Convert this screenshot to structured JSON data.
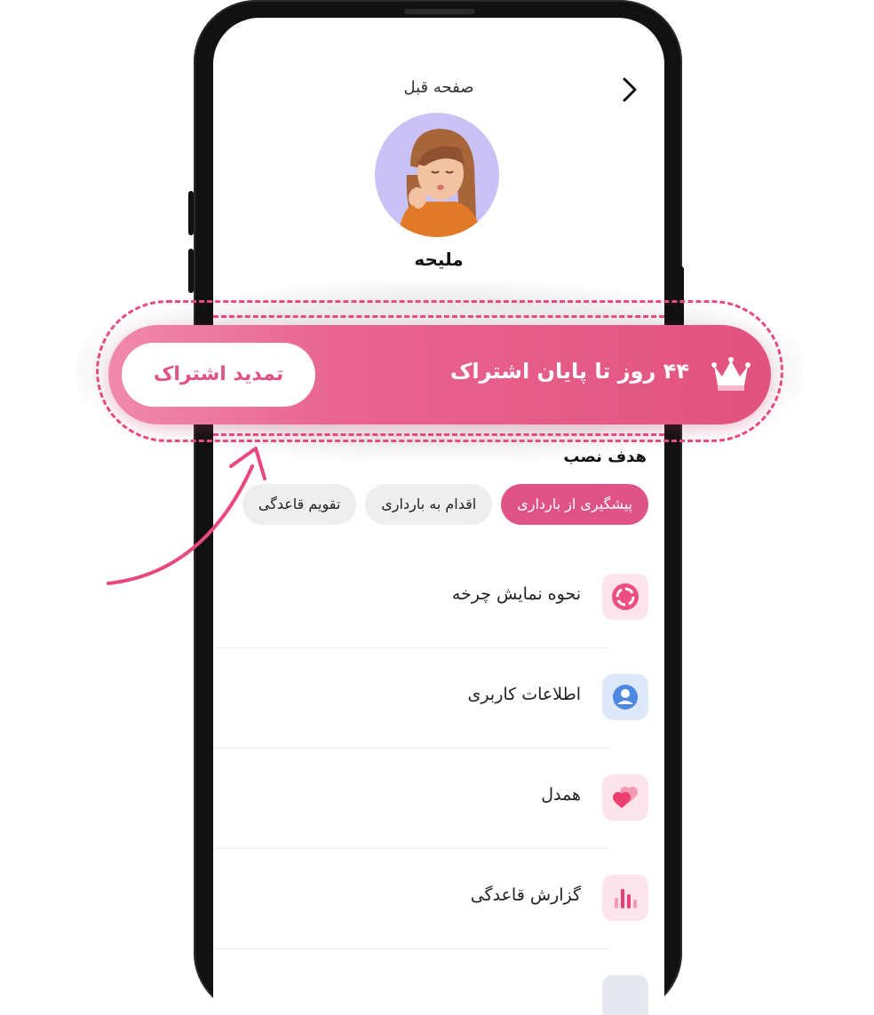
{
  "header": {
    "back_label": "صفحه قبل"
  },
  "profile": {
    "name": "ملیحه"
  },
  "subscription_banner": {
    "days_text": "۴۴ روز تا پایان اشتراک",
    "renew_label": "تمدید اشتراک"
  },
  "goal_section": {
    "title": "هدف نصب",
    "chips": [
      {
        "label": "پیشگیری از بارداری",
        "active": true
      },
      {
        "label": "اقدام به بارداری",
        "active": false
      },
      {
        "label": "تقویم قاعدگی",
        "active": false
      }
    ]
  },
  "menu": [
    {
      "label": "نحوه نمایش چرخه",
      "icon": "cycle-icon"
    },
    {
      "label": "اطلاعات کاربری",
      "icon": "user-icon"
    },
    {
      "label": "همدل",
      "icon": "hearts-icon"
    },
    {
      "label": "گزارش قاعدگی",
      "icon": "bar-chart-icon"
    }
  ],
  "colors": {
    "accent": "#e05386",
    "banner_start": "#f089ae",
    "banner_end": "#e2537f"
  }
}
